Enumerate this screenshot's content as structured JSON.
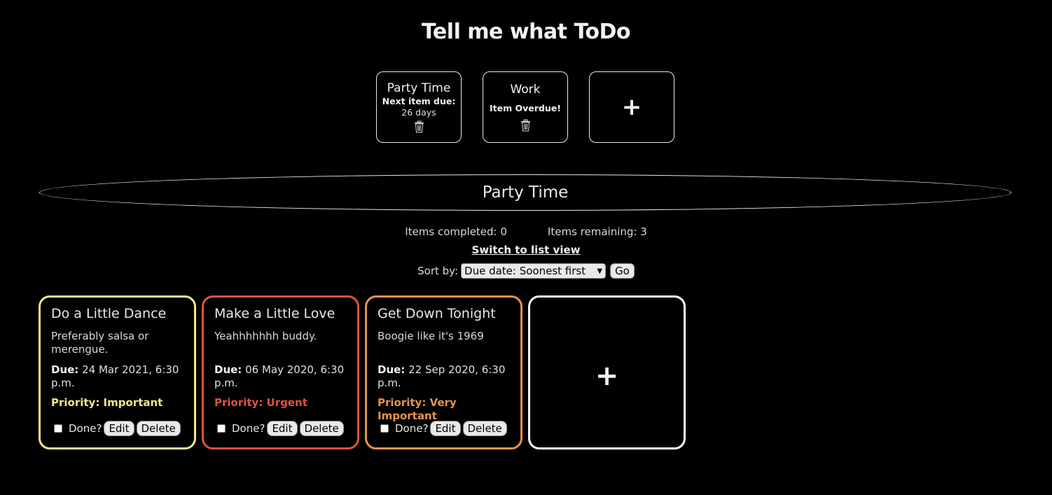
{
  "app": {
    "title": "Tell me what ToDo"
  },
  "lists": [
    {
      "name": "Party Time",
      "due_label": "Next item due:",
      "due_value": "26 days"
    },
    {
      "name": "Work",
      "status": "Item Overdue!"
    }
  ],
  "add_symbol": "+",
  "current_list": {
    "title": "Party Time",
    "completed_text": "Items completed: 0",
    "remaining_text": "Items remaining: 3",
    "switch_view_label": "Switch to list view"
  },
  "sort": {
    "label": "Sort by:",
    "selected": "Due date: Soonest first",
    "go_label": "Go"
  },
  "due_label": "Due:",
  "done_label": "Done?",
  "edit_label": "Edit",
  "delete_label": "Delete",
  "tasks": [
    {
      "title": "Do a Little Dance",
      "description": "Preferably salsa or merengue.",
      "due": "24 Mar 2021, 6:30 p.m.",
      "priority": "Priority: Important",
      "color": "#f5e784",
      "done": false
    },
    {
      "title": "Make a Little Love",
      "description": "Yeahhhhhhh buddy.",
      "due": "06 May 2020, 6:30 p.m.",
      "priority": "Priority: Urgent",
      "color": "#e0533a",
      "done": false
    },
    {
      "title": "Get Down Tonight",
      "description": "Boogie like it's 1969",
      "due": "22 Sep 2020, 6:30 p.m.",
      "priority": "Priority: Very Important",
      "color": "#e6934a",
      "done": false
    }
  ]
}
